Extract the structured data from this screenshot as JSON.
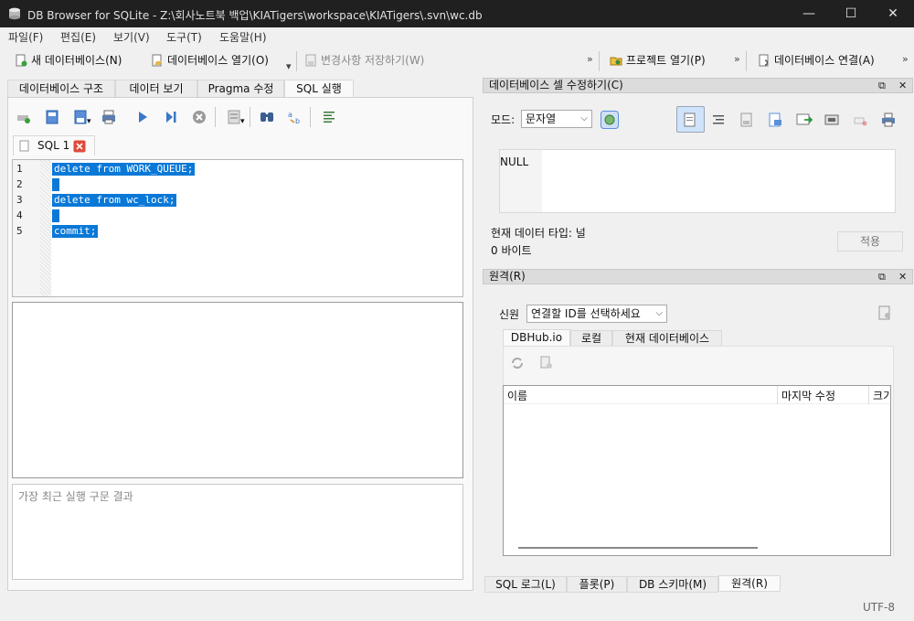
{
  "window": {
    "title": "DB Browser for SQLite - Z:\\회사노트북 백업\\KIATigers\\workspace\\KIATigers\\.svn\\wc.db",
    "minimize": "—",
    "maximize": "☐",
    "close": "✕"
  },
  "menu": {
    "items": [
      "파일(F)",
      "편집(E)",
      "보기(V)",
      "도구(T)",
      "도움말(H)"
    ]
  },
  "toolbar": {
    "new_db": "새 데이터베이스(N)",
    "open_db": "데이터베이스 열기(O)",
    "write_changes": "변경사항 저장하기(W)",
    "open_project": "프로젝트 열기(P)",
    "attach_db": "데이터베이스 연결(A)",
    "more": "»"
  },
  "left_tabs": [
    "데이터베이스 구조",
    "데이터 보기",
    "Pragma 수정",
    "SQL 실행"
  ],
  "sql_tab": {
    "label": "SQL 1"
  },
  "editor": {
    "line_numbers": [
      "1",
      "2",
      "3",
      "4",
      "5"
    ],
    "lines": [
      "delete from WORK_QUEUE;",
      "",
      "delete from wc_lock;",
      "",
      "commit;"
    ]
  },
  "message": {
    "placeholder": "가장 최근 실행 구문 결과"
  },
  "cell_editor": {
    "title": "데이터베이스 셀 수정하기(C)",
    "mode_label": "모드:",
    "mode_value": "문자열",
    "null_text": "NULL",
    "data_type": "현재 데이터 타입: 널",
    "size": "0 바이트",
    "apply": "적용"
  },
  "remote": {
    "title": "원격(R)",
    "identity_label": "신원",
    "identity_value": "연결할 ID를 선택하세요",
    "tabs": [
      "DBHub.io",
      "로컬",
      "현재 데이터베이스"
    ],
    "columns": [
      "이름",
      "마지막 수정",
      "크기"
    ]
  },
  "bottom_tabs": [
    "SQL 로그(L)",
    "플롯(P)",
    "DB 스키마(M)",
    "원격(R)"
  ],
  "status": {
    "encoding": "UTF-8"
  },
  "colors": {
    "selection": "#0a78d7",
    "titlebar": "#202020",
    "close_red": "#e04a3a"
  }
}
